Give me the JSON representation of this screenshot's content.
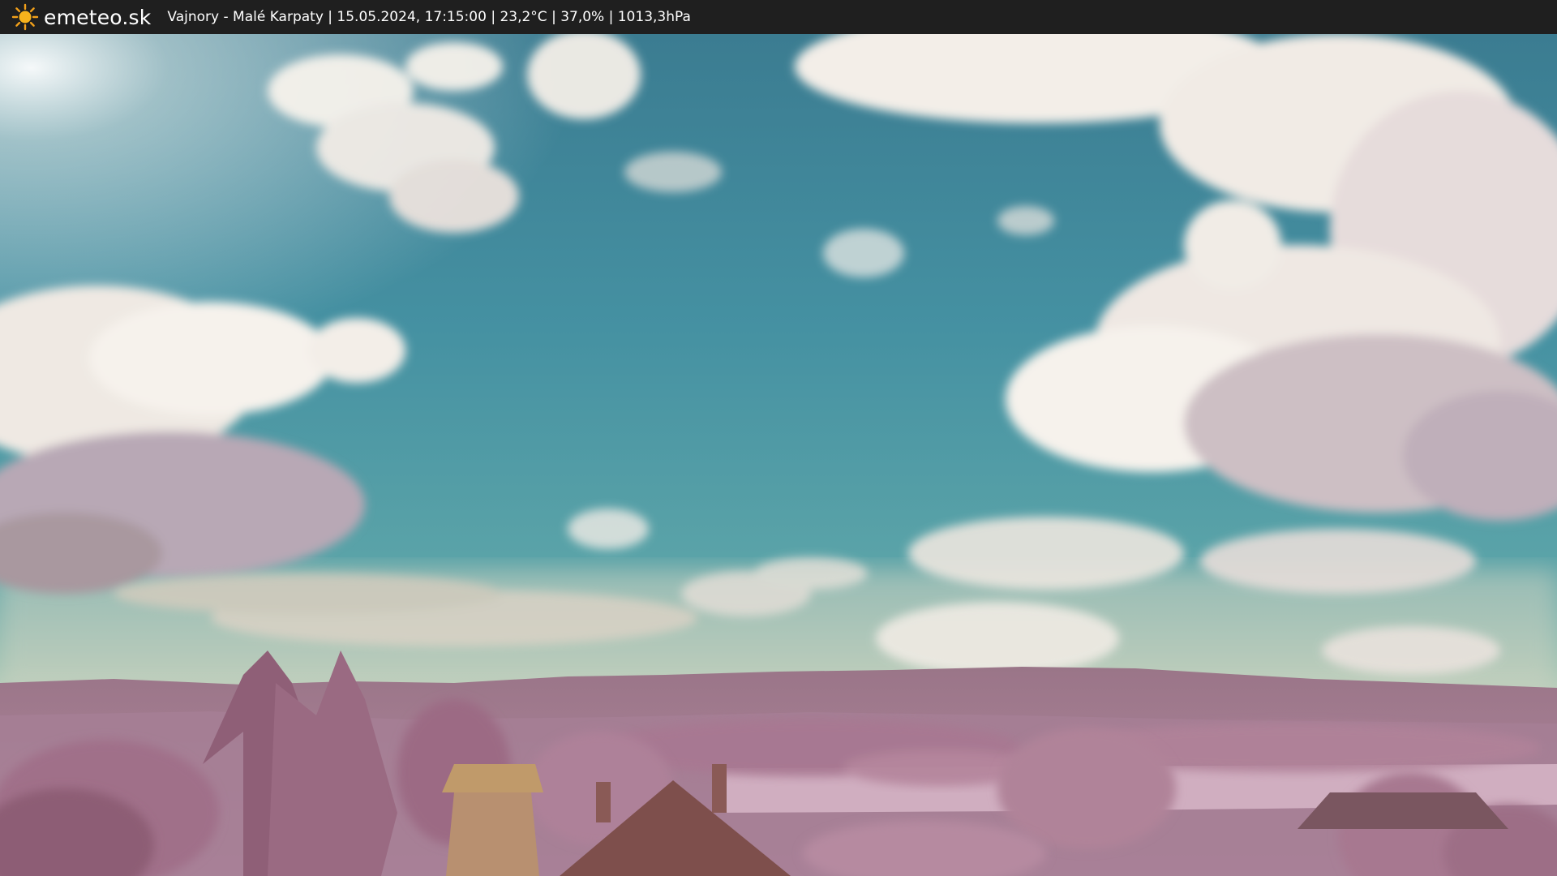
{
  "header": {
    "logo_icon": "sun-icon",
    "brand": "emeteo.sk",
    "caption": "Vajnory - Malé Karpaty | 15.05.2024, 17:15:00 | 23,2°C | 37,0% | 1013,3hPa"
  },
  "colors": {
    "bar": "#1f1f1f",
    "sky_top": "#3a7e93",
    "sky_mid": "#4a98a5",
    "sky_low": "#8ab8b0",
    "cloud": "#f4f0ea",
    "cloud_shadow": "#b6a6b2",
    "hills": "#8d6a80",
    "foliage": "#a77890",
    "field": "#cfa9bc",
    "roof": "#8a5a56",
    "roof_light": "#b89070"
  }
}
